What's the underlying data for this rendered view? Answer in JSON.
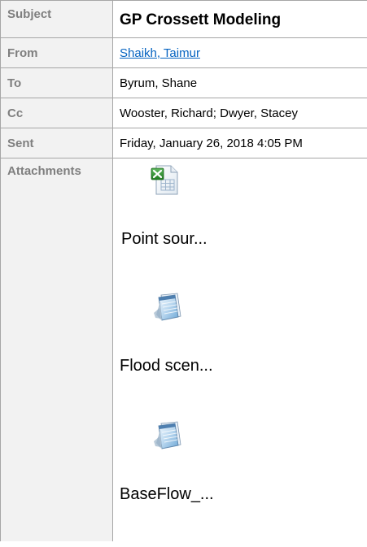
{
  "header": {
    "subject": {
      "label": "Subject",
      "value": "GP Crossett Modeling"
    },
    "from": {
      "label": "From",
      "value": "Shaikh, Taimur"
    },
    "to": {
      "label": "To",
      "value": "Byrum, Shane"
    },
    "cc": {
      "label": "Cc",
      "value": "Wooster, Richard; Dwyer, Stacey"
    },
    "sent": {
      "label": "Sent",
      "value": "Friday, January 26, 2018 4:05 PM"
    },
    "attachments": {
      "label": "Attachments"
    }
  },
  "attachments": [
    {
      "name": "Point sour...",
      "icon": "excel-file-icon"
    },
    {
      "name": "Flood scen...",
      "icon": "notepad-file-icon"
    },
    {
      "name": "BaseFlow_...",
      "icon": "notepad-file-icon"
    }
  ],
  "colors": {
    "label_text": "#7f7f7f",
    "label_bg": "#f2f2f2",
    "border": "#a6a6a6",
    "link": "#0563c1"
  }
}
